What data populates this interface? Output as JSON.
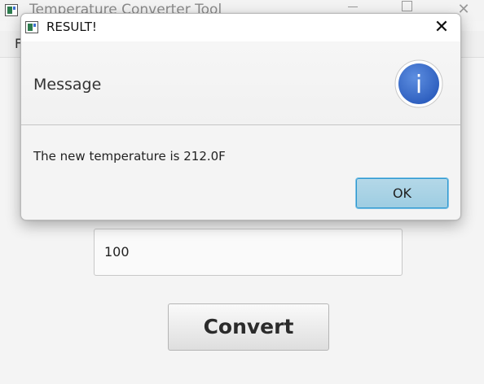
{
  "main_window": {
    "title": "Temperature Converter Tool",
    "menu_first_letter": "F",
    "value_field": "100",
    "convert_label": "Convert"
  },
  "dialog": {
    "title": "RESULT!",
    "header_text": "Message",
    "info_icon_glyph": "i",
    "message": "The new temperature is 212.0F",
    "ok_label": "OK",
    "close_glyph": "✕",
    "accent_color": "#3a6fce"
  },
  "icons": {
    "app": "app-icon",
    "info": "info-icon",
    "close": "close-icon"
  }
}
